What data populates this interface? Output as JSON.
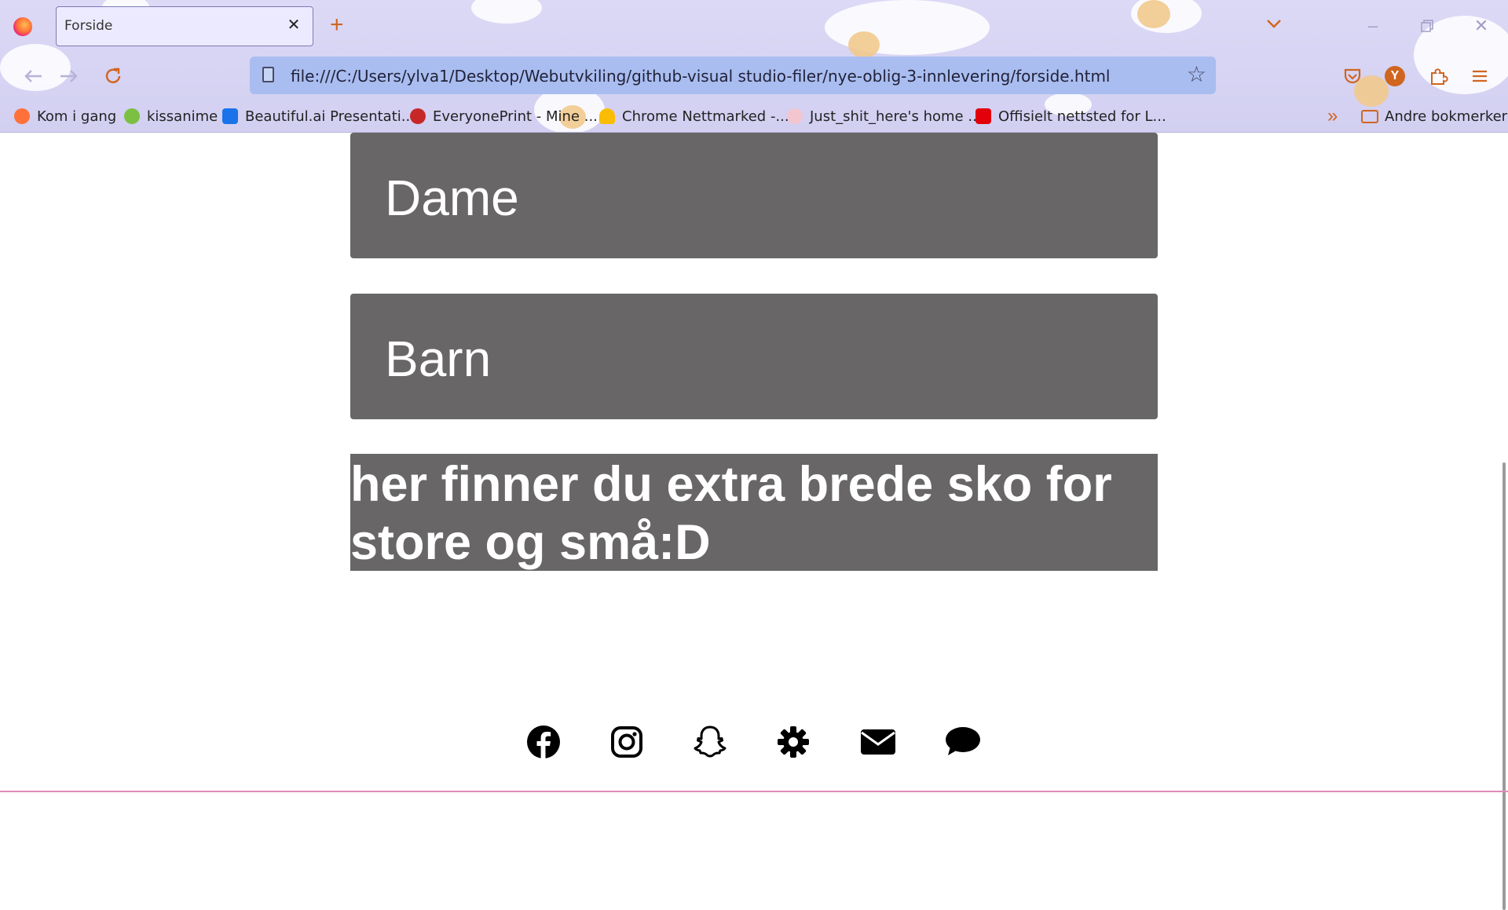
{
  "browser": {
    "tab_title": "Forside",
    "tab_close": "✕",
    "new_tab": "+",
    "url": "file:///C:/Users/ylva1/Desktop/Webutvkiling/github-visual studio-filer/nye-oblig-3-innlevering/forside.html",
    "avatar_letter": "Y",
    "accent": "#d0651f",
    "bookmarks": [
      {
        "label": "Kom i gang",
        "icon": "firefox-icon",
        "color": "#ff7139"
      },
      {
        "label": "kissanime",
        "icon": "kissanime-icon",
        "color": "#7bc043"
      },
      {
        "label": "Beautiful.ai Presentati...",
        "icon": "beautiful-ai-icon",
        "color": "#1a73e8"
      },
      {
        "label": "EveryonePrint - Mine ...",
        "icon": "everyoneprint-icon",
        "color": "#c62828"
      },
      {
        "label": "Chrome Nettmarked -...",
        "icon": "chrome-webstore-icon",
        "color": "#fbbc05"
      },
      {
        "label": "Just_shit_here's home ...",
        "icon": "just-shit-icon",
        "color": "#f3c6cf"
      },
      {
        "label": "Offisielt nettsted for L...",
        "icon": "lego-icon",
        "color": "#e3000b"
      }
    ],
    "other_bookmarks": "Andre bokmerker"
  },
  "page": {
    "sections": [
      {
        "label": "Dame"
      },
      {
        "label": "Barn"
      }
    ],
    "banner_text": "her finner du extra brede sko for store og små:D",
    "box_color": "#686667",
    "social_icons": [
      "facebook-icon",
      "instagram-icon",
      "snapchat-icon",
      "gear-icon",
      "mail-icon",
      "chat-icon"
    ]
  }
}
